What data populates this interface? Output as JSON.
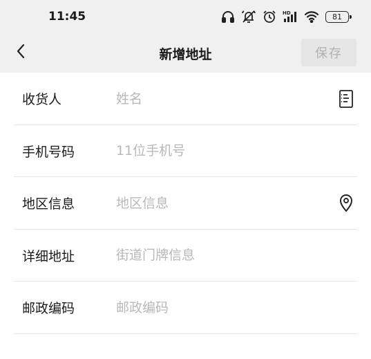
{
  "status_bar": {
    "time": "11:45",
    "battery": "81",
    "icons": [
      "headphones-icon",
      "mute-icon",
      "alarm-icon",
      "hd-signal-icon",
      "wifi-icon",
      "battery-icon"
    ]
  },
  "nav": {
    "back_icon": "chevron-left-icon",
    "title": "新增地址",
    "save_label": "保存"
  },
  "form": {
    "rows": [
      {
        "label": "收货人",
        "placeholder": "姓名",
        "icon": "contact-book-icon"
      },
      {
        "label": "手机号码",
        "placeholder": "11位手机号"
      },
      {
        "label": "地区信息",
        "placeholder": "地区信息",
        "icon": "location-pin-icon"
      },
      {
        "label": "详细地址",
        "placeholder": "街道门牌信息"
      },
      {
        "label": "邮政编码",
        "placeholder": "邮政编码"
      }
    ]
  },
  "colors": {
    "header_bg": "#f0f0f0",
    "save_button_bg": "#e6e6e6",
    "save_button_text": "#b0b0b0",
    "placeholder_text": "#b8b8b8",
    "divider": "#e5e5e5"
  }
}
